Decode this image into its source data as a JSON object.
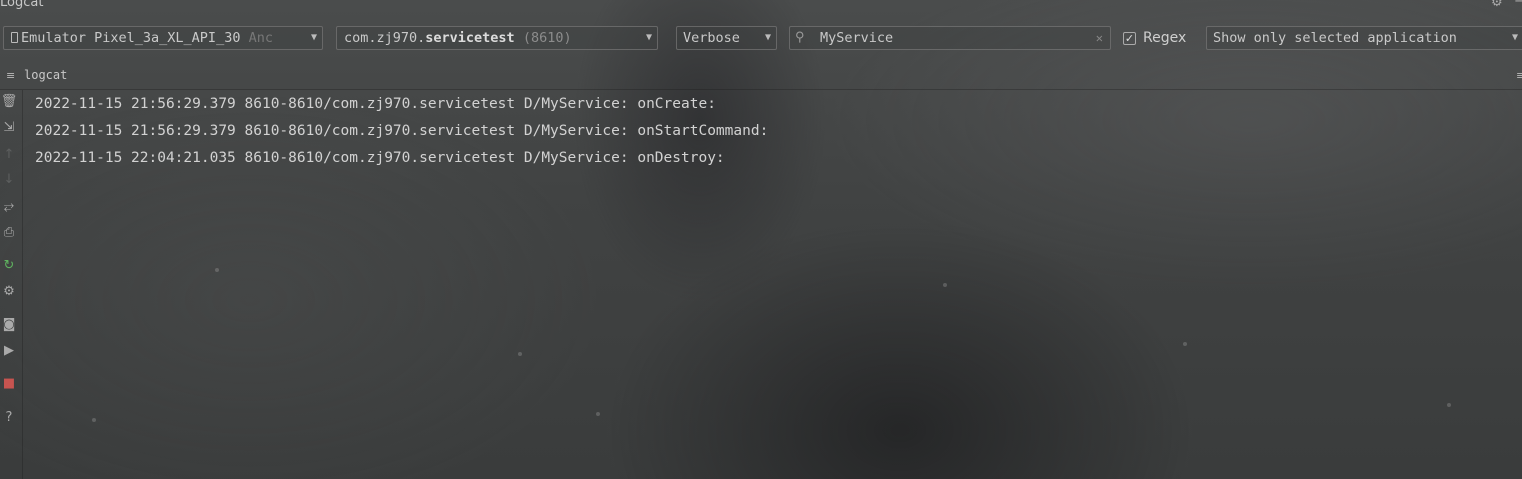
{
  "window": {
    "title": "Logcat",
    "title_icons": [
      "gear-icon",
      "minimize-icon"
    ]
  },
  "toolbar": {
    "device": {
      "name": "Emulator Pixel_3a_XL_API_30",
      "suffix": "Anc",
      "icon": "device-icon"
    },
    "process": {
      "package_prefix": "com.zj970.",
      "package_bold": "servicetest",
      "pid": "(8610)"
    },
    "log_level": "Verbose",
    "search": {
      "value": "MyService",
      "icon": "search-icon"
    },
    "regex": {
      "label": "Regex",
      "checked": true
    },
    "filter": "Show only selected application"
  },
  "tab": {
    "label": "logcat"
  },
  "sidebar": {
    "icons": [
      "trash-icon",
      "scroll-to-end-icon",
      "up-arrow-icon",
      "down-arrow-icon",
      "soft-wrap-icon",
      "print-icon",
      "restart-icon",
      "settings-icon",
      "screenshot-icon",
      "screen-record-icon",
      "stop-icon",
      "help-icon"
    ]
  },
  "log": {
    "lines": [
      "2022-11-15 21:56:29.379 8610-8610/com.zj970.servicetest D/MyService: onCreate:",
      "2022-11-15 21:56:29.379 8610-8610/com.zj970.servicetest D/MyService: onStartCommand:",
      "2022-11-15 22:04:21.035 8610-8610/com.zj970.servicetest D/MyService: onDestroy:"
    ]
  },
  "colors": {
    "stop": "#c75450",
    "restart": "#5fb35f"
  }
}
